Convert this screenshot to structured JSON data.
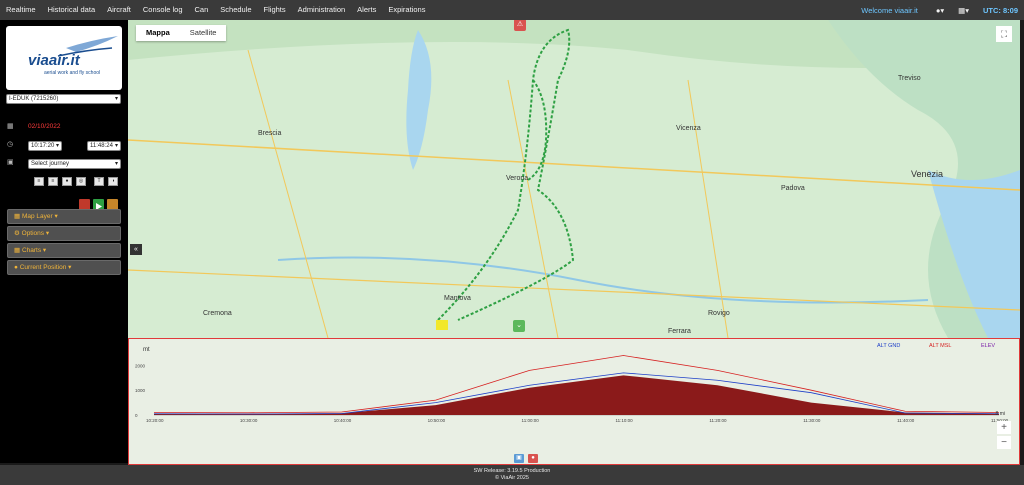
{
  "nav": {
    "items": [
      "Realtime",
      "Historical data",
      "Aircraft",
      "Console log",
      "Can",
      "Schedule",
      "Flights",
      "Administration",
      "Alerts",
      "Expirations"
    ],
    "welcome": "Welcome viaair.it",
    "user_icon": "user-icon",
    "menu_icon": "grid-icon",
    "utc": "UTC: 8:09"
  },
  "sidebar": {
    "logo_text": "viaair.it",
    "logo_sub": "aerial work and fly school",
    "aircraft": "I-EDUK (7215260)",
    "date": "02/10/2022",
    "time_from": "10:17:20",
    "time_to": "11:48:24",
    "journey_placeholder": "Select journey",
    "tool_icons": [
      "list-icon",
      "list-icon",
      "marker-icon",
      "target-icon",
      "text-icon",
      "globe-icon"
    ],
    "control_colors": [
      "#c0392b",
      "#2ea043",
      "#c6862a"
    ],
    "panels": [
      "Map Layer",
      "Options",
      "Charts",
      "Current Position"
    ]
  },
  "map": {
    "tabs": [
      "Mappa",
      "Satellite"
    ],
    "active_tab": "Mappa",
    "city_labels": [
      "Brescia",
      "Verona",
      "Vicenza",
      "Padova",
      "Venezia",
      "Cremona",
      "Mantova",
      "Rovigo",
      "Treviso",
      "Ferrara"
    ]
  },
  "chart": {
    "unit_label": "mt",
    "legend": [
      "ALT GND",
      "ALT MSL",
      "ELEV"
    ],
    "legend_colors": [
      "#1e3fc8",
      "#d62020",
      "#7a1ea8"
    ],
    "unit_right": "8 mi"
  },
  "chart_data": {
    "type": "area",
    "x": [
      "10:20:00",
      "10:30:00",
      "10:40:00",
      "10:50:00",
      "11:00:00",
      "11:10:00",
      "11:20:00",
      "11:30:00",
      "11:40:00",
      "11:50:00"
    ],
    "y_ticks": [
      0,
      1000,
      2000
    ],
    "series": [
      {
        "name": "ALT GND",
        "values": [
          50,
          40,
          60,
          500,
          1200,
          1700,
          1400,
          900,
          80,
          50
        ]
      },
      {
        "name": "ALT MSL",
        "values": [
          100,
          90,
          120,
          600,
          1800,
          2400,
          1800,
          1000,
          150,
          100
        ]
      },
      {
        "name": "ELEV",
        "values": [
          60,
          50,
          70,
          400,
          1100,
          1600,
          1200,
          500,
          100,
          60
        ]
      }
    ],
    "ylim": [
      0,
      2500
    ]
  },
  "footer": {
    "line1": "SW Release: 3.19.5 Production",
    "line2": "© ViaAir 2025"
  }
}
